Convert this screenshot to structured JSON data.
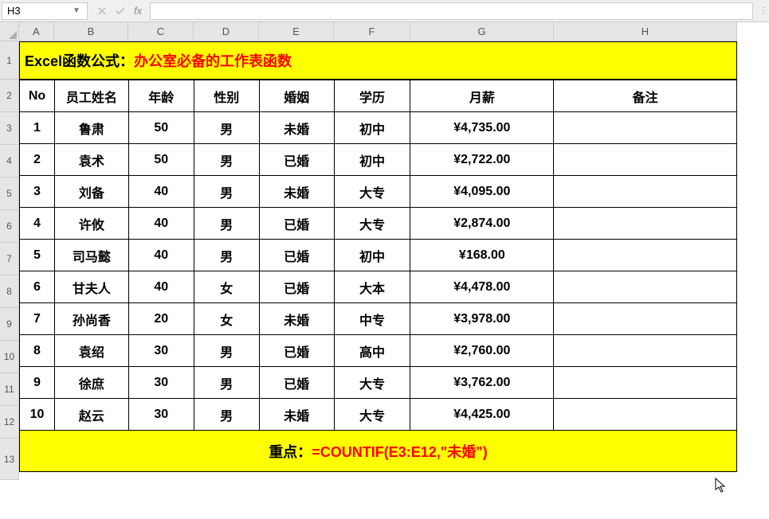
{
  "formula_bar": {
    "cell_ref": "H3",
    "formula": ""
  },
  "columns": [
    "A",
    "B",
    "C",
    "D",
    "E",
    "F",
    "G",
    "H"
  ],
  "rows": [
    "1",
    "2",
    "3",
    "4",
    "5",
    "6",
    "7",
    "8",
    "9",
    "10",
    "11",
    "12",
    "13"
  ],
  "title": {
    "prefix": "Excel函数公式：",
    "main": "办公室必备的工作表函数"
  },
  "headers": {
    "no": "No",
    "name": "员工姓名",
    "age": "年龄",
    "gender": "性别",
    "marital": "婚姻",
    "education": "学历",
    "salary": "月薪",
    "remark": "备注"
  },
  "data": [
    {
      "no": "1",
      "name": "鲁肃",
      "age": "50",
      "gender": "男",
      "marital": "未婚",
      "education": "初中",
      "salary": "¥4,735.00",
      "remark": ""
    },
    {
      "no": "2",
      "name": "袁术",
      "age": "50",
      "gender": "男",
      "marital": "已婚",
      "education": "初中",
      "salary": "¥2,722.00",
      "remark": ""
    },
    {
      "no": "3",
      "name": "刘备",
      "age": "40",
      "gender": "男",
      "marital": "未婚",
      "education": "大专",
      "salary": "¥4,095.00",
      "remark": ""
    },
    {
      "no": "4",
      "name": "许攸",
      "age": "40",
      "gender": "男",
      "marital": "已婚",
      "education": "大专",
      "salary": "¥2,874.00",
      "remark": ""
    },
    {
      "no": "5",
      "name": "司马懿",
      "age": "40",
      "gender": "男",
      "marital": "已婚",
      "education": "初中",
      "salary": "¥168.00",
      "remark": ""
    },
    {
      "no": "6",
      "name": "甘夫人",
      "age": "40",
      "gender": "女",
      "marital": "已婚",
      "education": "大本",
      "salary": "¥4,478.00",
      "remark": ""
    },
    {
      "no": "7",
      "name": "孙尚香",
      "age": "20",
      "gender": "女",
      "marital": "未婚",
      "education": "中专",
      "salary": "¥3,978.00",
      "remark": ""
    },
    {
      "no": "8",
      "name": "袁绍",
      "age": "30",
      "gender": "男",
      "marital": "已婚",
      "education": "高中",
      "salary": "¥2,760.00",
      "remark": ""
    },
    {
      "no": "9",
      "name": "徐庶",
      "age": "30",
      "gender": "男",
      "marital": "已婚",
      "education": "大专",
      "salary": "¥3,762.00",
      "remark": ""
    },
    {
      "no": "10",
      "name": "赵云",
      "age": "30",
      "gender": "男",
      "marital": "未婚",
      "education": "大专",
      "salary": "¥4,425.00",
      "remark": ""
    }
  ],
  "footer": {
    "label": "重点：",
    "formula": "=COUNTIF(E3:E12,\"未婚\")"
  }
}
